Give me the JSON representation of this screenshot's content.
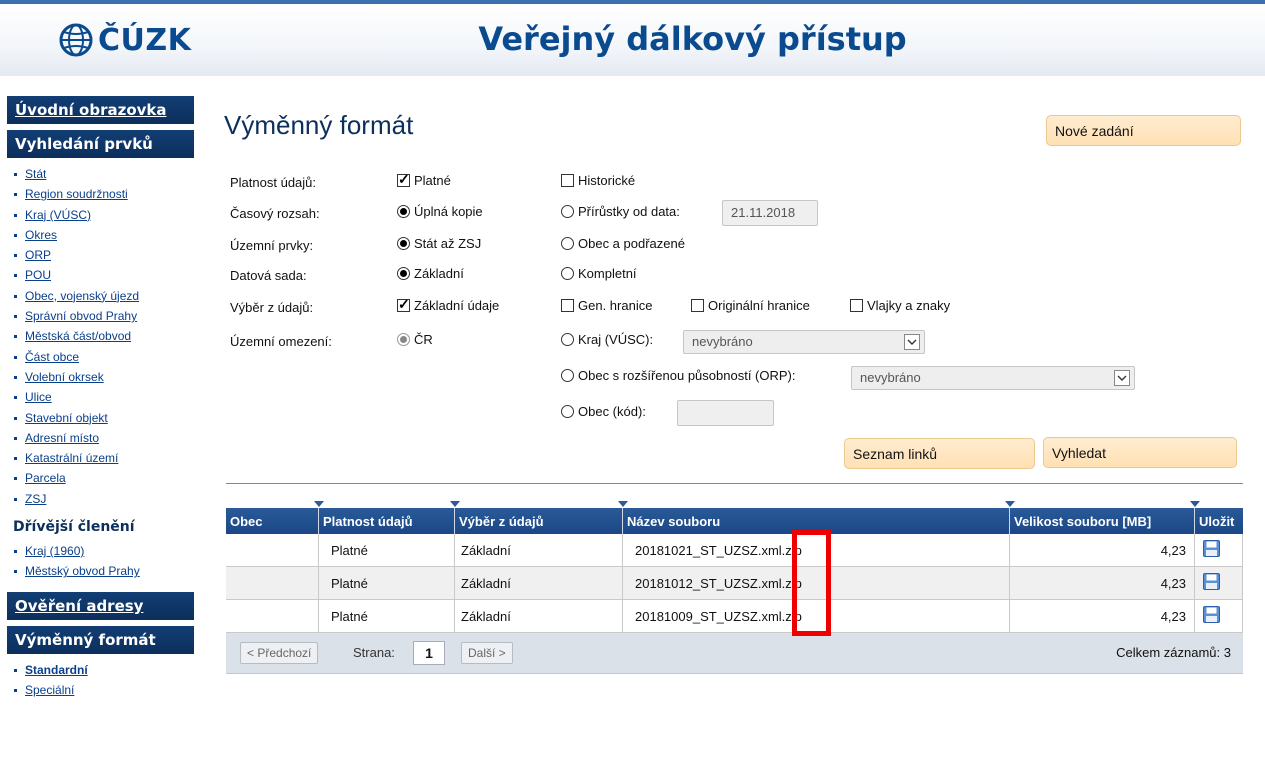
{
  "header": {
    "logo_text": "ČÚZK",
    "title": "Veřejný dálkový přístup"
  },
  "sidebar": {
    "home": "Úvodní obrazovka",
    "search_header": "Vyhledání prvků",
    "search_items": [
      "Stát",
      "Region soudržnosti",
      "Kraj (VÚSC)",
      "Okres",
      "ORP",
      "POU",
      "Obec, vojenský újezd",
      "Správní obvod Prahy",
      "Městská část/obvod",
      "Část obce",
      "Volební okrsek",
      "Ulice",
      "Stavební objekt",
      "Adresní místo",
      "Katastrální území",
      "Parcela",
      "ZSJ"
    ],
    "former_header": "Dřívější členění",
    "former_items": [
      "Kraj (1960)",
      "Městský obvod Prahy"
    ],
    "verify_header": "Ověření adresy",
    "exchange_header": "Výměnný formát",
    "exchange_items": [
      "Standardní",
      "Speciální"
    ]
  },
  "main": {
    "title": "Výměnný formát",
    "new_button": "Nové zadání"
  },
  "form": {
    "validity": {
      "label": "Platnost údajů:",
      "opt1": "Platné",
      "opt2": "Historické"
    },
    "time_range": {
      "label": "Časový rozsah:",
      "opt1": "Úplná kopie",
      "opt2": "Přírůstky od data:",
      "date": "21.11.2018"
    },
    "territorial": {
      "label": "Územní prvky:",
      "opt1": "Stát až ZSJ",
      "opt2": "Obec a podřazené"
    },
    "dataset": {
      "label": "Datová sada:",
      "opt1": "Základní",
      "opt2": "Kompletní"
    },
    "selection": {
      "label": "Výběr z údajů:",
      "opt1": "Základní údaje",
      "opt2": "Gen. hranice",
      "opt3": "Originální hranice",
      "opt4": "Vlajky a znaky"
    },
    "restriction": {
      "label": "Územní omezení:",
      "opt1": "ČR",
      "opt2": "Kraj (VÚSC):",
      "opt2_select": "nevybráno",
      "opt3": "Obec s rozšířenou působností (ORP):",
      "opt3_select": "nevybráno",
      "opt4": "Obec (kód):"
    }
  },
  "actions": {
    "links": "Seznam linků",
    "search": "Vyhledat"
  },
  "table": {
    "headers": [
      "Obec",
      "Platnost údajů",
      "Výběr z údajů",
      "Název souboru",
      "Velikost souboru [MB]",
      "Uložit"
    ],
    "rows": [
      {
        "obec": "",
        "validity": "Platné",
        "selection": "Základní",
        "file": "20181021_ST_UZSZ.xml.zip",
        "size": "4,23"
      },
      {
        "obec": "",
        "validity": "Platné",
        "selection": "Základní",
        "file": "20181012_ST_UZSZ.xml.zip",
        "size": "4,23"
      },
      {
        "obec": "",
        "validity": "Platné",
        "selection": "Základní",
        "file": "20181009_ST_UZSZ.xml.zip",
        "size": "4,23"
      }
    ]
  },
  "pager": {
    "prev": "< Předchozí",
    "page_label": "Strana:",
    "page": "1",
    "next": "Další >",
    "total": "Celkem záznamů: 3"
  },
  "colors": {
    "navy": "#0c2f5c",
    "link": "#0a3f8a",
    "peach": "#ffe6c2",
    "highlight": "#ee0000"
  }
}
